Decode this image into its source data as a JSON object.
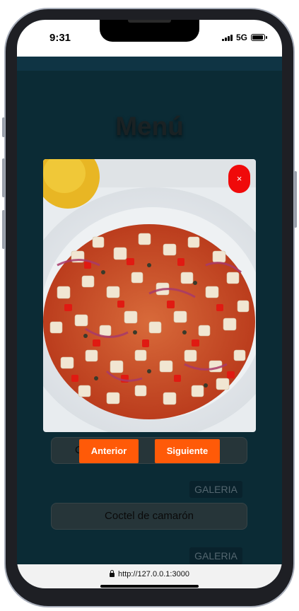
{
  "status_bar": {
    "time": "9:31",
    "network": "5G",
    "icons": [
      "signal-bars-icon",
      "battery-icon"
    ]
  },
  "page": {
    "title": "Menú",
    "items": [
      {
        "name": "Coctel de camarón"
      }
    ],
    "first_item_visible": "C",
    "first_item_mid": "mp",
    "gallery_label": "GALERIA"
  },
  "modal": {
    "close_label": "×",
    "prev_label": "Anterior",
    "next_label": "Siguiente",
    "image_alt": "photo of a fish ceviche dish"
  },
  "browser": {
    "url": "http://127.0.0.1:3000",
    "lock_icon": "lock-icon"
  },
  "colors": {
    "accent": "#ff5a08",
    "close": "#f00a0a",
    "app_background": "#0c2f3a"
  }
}
